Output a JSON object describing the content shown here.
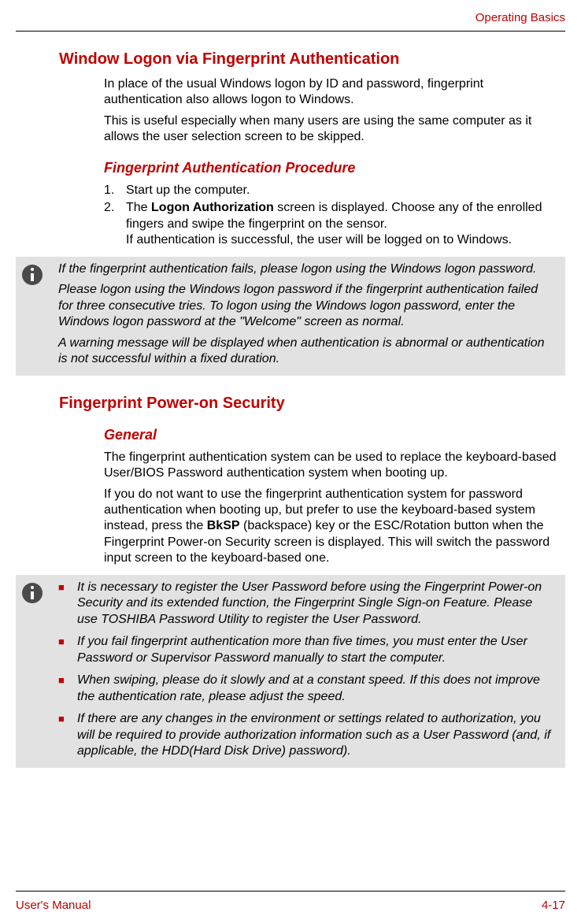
{
  "header": {
    "section": "Operating Basics"
  },
  "sections": {
    "windowLogon": {
      "title": "Window Logon via Fingerprint Authentication",
      "p1": "In place of the usual Windows logon by ID and password, fingerprint authentication also allows logon to Windows.",
      "p2": "This is useful especially when many users are using the same computer as it allows the user selection screen to be skipped.",
      "procedure": {
        "title": "Fingerprint Authentication Procedure",
        "steps": {
          "s1_num": "1.",
          "s1_text": "Start up the computer.",
          "s2_num": "2.",
          "s2_text_a": "The ",
          "s2_bold": "Logon Authorization",
          "s2_text_b": " screen is displayed. Choose any of the enrolled fingers and swipe the fingerprint on the sensor.",
          "s2_text_c": "If authentication is successful, the user will be logged on to Windows."
        }
      },
      "note": {
        "p1": "If the fingerprint authentication fails, please logon using the Windows logon password.",
        "p2": "Please logon using the Windows logon password if the fingerprint authentication failed for three consecutive tries. To logon using the Windows logon password, enter the Windows logon password at the \"Welcome\" screen as normal.",
        "p3": "A warning message will be displayed when authentication is abnormal or authentication is not successful within a fixed duration."
      }
    },
    "powerOn": {
      "title": "Fingerprint Power-on Security",
      "general": {
        "title": "General",
        "p1": "The fingerprint authentication system can be used to replace the keyboard-based User/BIOS Password authentication system when booting up.",
        "p2_a": "If you do not want to use the fingerprint authentication system for password authentication when booting up, but prefer to use the keyboard-based system instead, press the ",
        "p2_bold": "BkSP",
        "p2_b": " (backspace) key or the ESC/Rotation button when the Fingerprint Power-on Security screen is displayed. This will switch the password input screen to the keyboard-based one."
      },
      "note": {
        "b1": "It is necessary to register the User Password before using the Fingerprint Power-on Security and its extended function, the Fingerprint Single Sign-on Feature. Please use TOSHIBA Password Utility to register the User Password.",
        "b2": "If you fail fingerprint authentication more than five times, you must enter the User Password or Supervisor Password manually to start the computer.",
        "b3": "When swiping, please do it slowly and at a constant speed. If this does not improve the authentication rate, please adjust the speed.",
        "b4": "If there are any changes in the environment or settings related to authorization, you will be required to provide authorization information such as a User Password (and, if applicable, the HDD(Hard Disk Drive) password)."
      }
    }
  },
  "footer": {
    "left": "User's Manual",
    "right": "4-17"
  }
}
